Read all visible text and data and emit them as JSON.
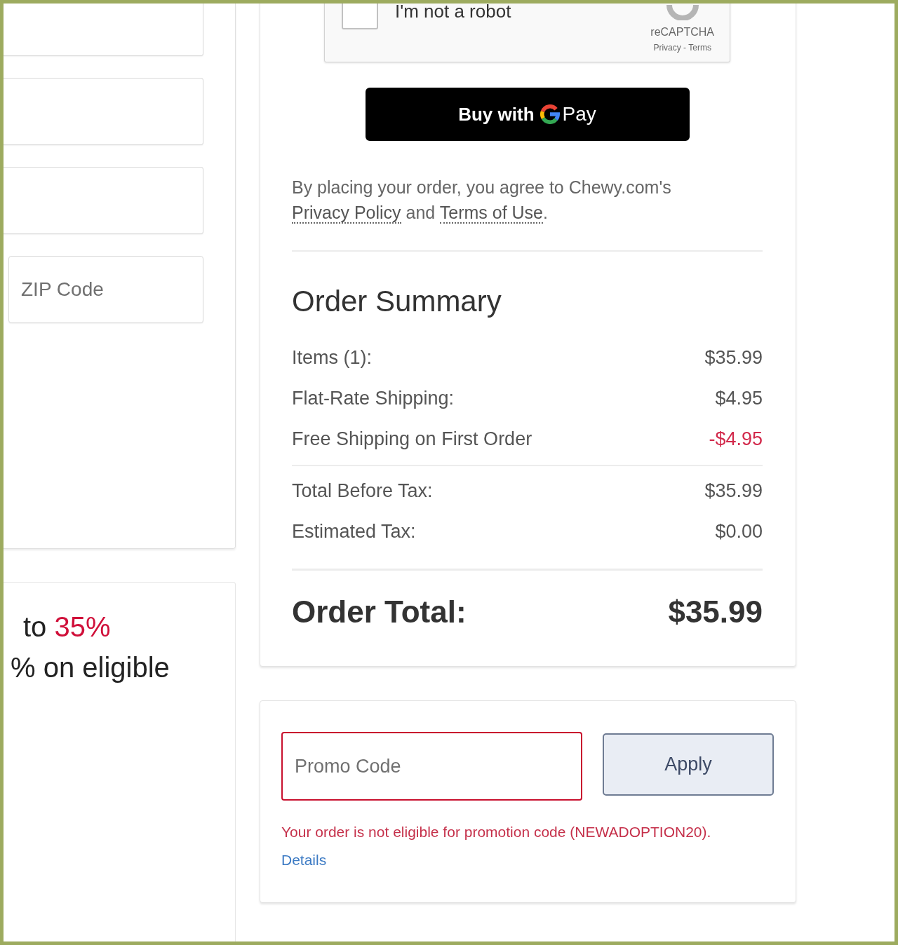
{
  "address_form": {
    "fields": [
      {
        "kind": "partial"
      },
      {
        "kind": "partial"
      },
      {
        "kind": "partial"
      },
      {
        "kind": "full",
        "placeholder": "ZIP Code"
      }
    ]
  },
  "offer_card": {
    "lines": [
      {
        "text": "to ",
        "accent": "35%"
      },
      {
        "text": "% on eligible"
      }
    ]
  },
  "checkout": {
    "captcha": {
      "checked": false,
      "label": "I'm not a robot",
      "brand": "reCAPTCHA",
      "links": "Privacy - Terms"
    },
    "pay_button": {
      "label_before": "Buy with",
      "label_after": "Pay"
    },
    "legal_notice": [
      {
        "kind": "text",
        "text": "By placing your order, you agree to Chewy.com's "
      },
      {
        "kind": "link",
        "text": "Privacy Policy"
      },
      {
        "kind": "text",
        "text": " and "
      },
      {
        "kind": "link",
        "text": "Terms of Use"
      },
      {
        "kind": "text",
        "text": "."
      }
    ],
    "order_summary": {
      "title": "Order Summary",
      "charges": [
        {
          "kind": "charge",
          "label": "Items (1):",
          "amount": "$35.99"
        },
        {
          "kind": "charge",
          "label": "Flat-Rate Shipping:",
          "amount": "$4.95"
        },
        {
          "kind": "discount",
          "label": "Free Shipping on First Order",
          "amount": "-$4.95"
        }
      ],
      "subtotals": [
        {
          "kind": "charge",
          "label": "Total Before Tax:",
          "amount": "$35.99"
        },
        {
          "kind": "charge",
          "label": "Estimated Tax:",
          "amount": "$0.00"
        }
      ],
      "order_total": {
        "label": "Order Total:",
        "amount": "$35.99"
      }
    }
  },
  "promo": {
    "field": {
      "placeholder": "Promo Code",
      "invalid": true
    },
    "apply_button": "Apply",
    "error": "Your order is not eligible for promotion code (NEWADOPTION20).",
    "details_link": "Details"
  }
}
